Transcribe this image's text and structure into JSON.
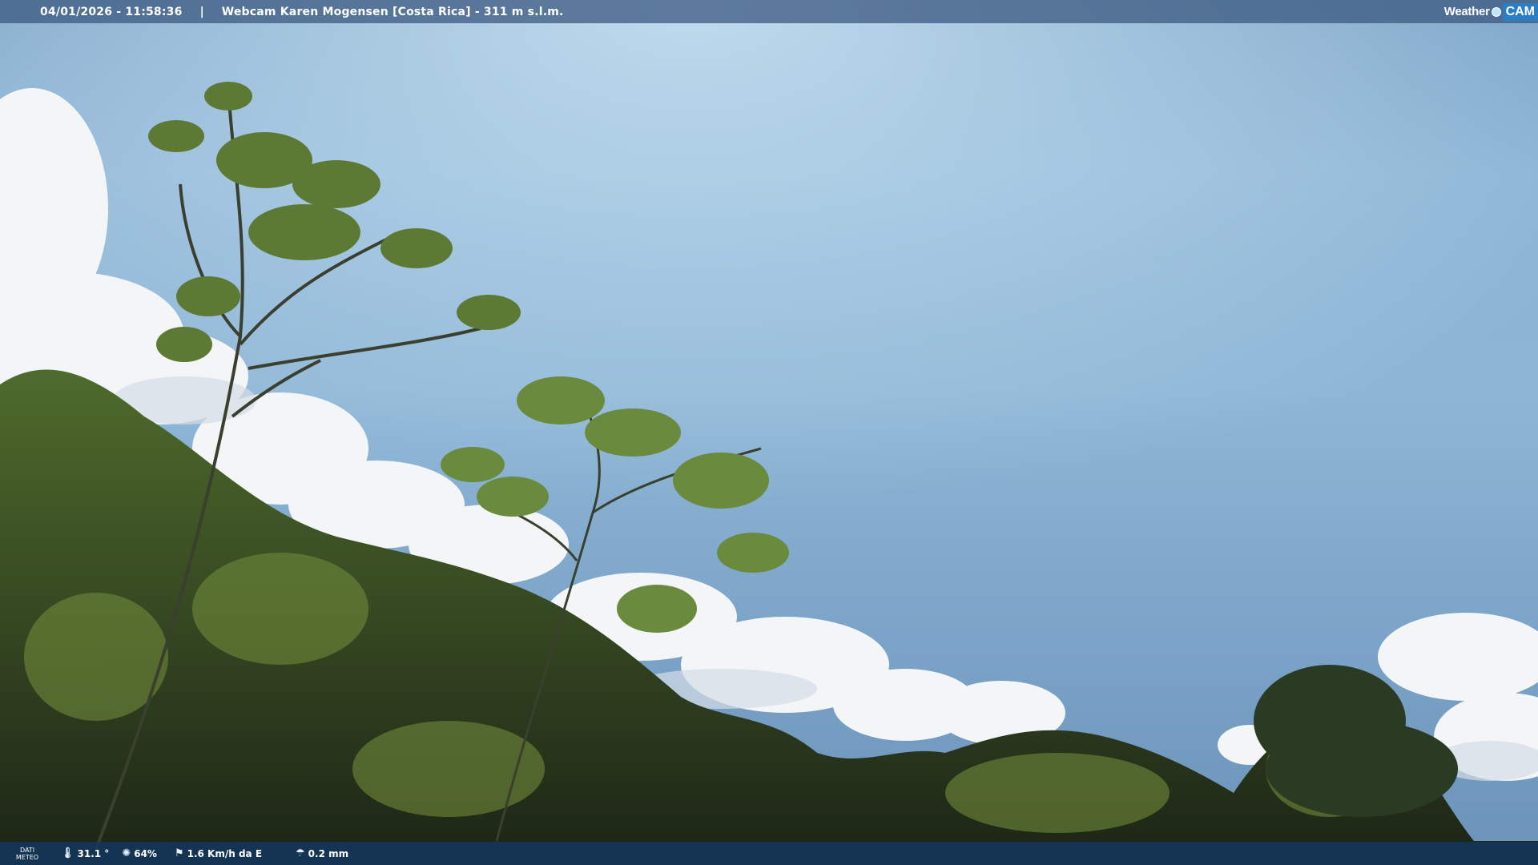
{
  "header": {
    "timestamp": "04/01/2026 - 11:58:36",
    "separator": "|",
    "title": "Webcam Karen Mogensen [Costa Rica] - 311 m s.l.m.",
    "logo_word1": "Weather",
    "logo_word2": "CAM"
  },
  "meteo": {
    "label_line1": "DATI",
    "label_line2": "METEO",
    "temperature": "31.1 °",
    "temperature_icon": "thermometer-icon",
    "humidity": "64%",
    "humidity_icon": "humidity-drop-icon",
    "wind": "1.6 Km/h da E",
    "wind_icon": "wind-icon",
    "rain": "0.2 mm",
    "rain_icon": "rain-icon"
  },
  "colors": {
    "sky_top": "#6f99bf",
    "sky_mid": "#8eb6d6",
    "cloud": "#f2f4f6",
    "foliage_dark": "#1f2a1a",
    "foliage_light": "#6f8a3a",
    "bar_top": "#37557d",
    "bar_bottom": "#14375f",
    "logo_accent": "#2a7fc4"
  }
}
